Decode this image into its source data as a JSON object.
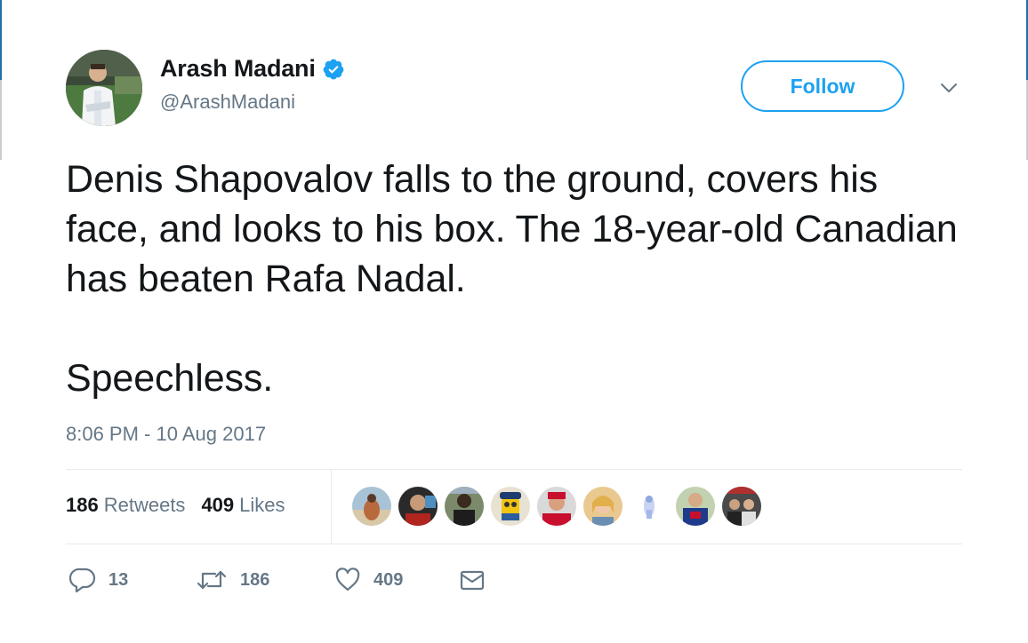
{
  "author": {
    "display_name": "Arash Madani",
    "handle": "@ArashMadani"
  },
  "follow_label": "Follow",
  "tweet": {
    "paragraph_1": "Denis Shapovalov falls to the ground, covers his face, and looks to his box. The 18-year-old Canadian has beaten Rafa Nadal.",
    "paragraph_2": "Speechless.",
    "timestamp": "8:06 PM - 10 Aug 2017"
  },
  "stats": {
    "retweets_count": "186",
    "retweets_label": "Retweets",
    "likes_count": "409",
    "likes_label": "Likes"
  },
  "actions": {
    "reply_count": "13",
    "retweet_count": "186",
    "like_count": "409"
  },
  "icons": {
    "verified": "verified-badge-icon",
    "chevron": "chevron-down-icon",
    "reply": "reply-bubble-icon",
    "retweet": "retweet-icon",
    "like": "heart-icon",
    "dm": "envelope-icon"
  },
  "colors": {
    "accent": "#1da1f2",
    "text": "#14171a",
    "secondary": "#657786",
    "divider": "#e6ecf0"
  },
  "liker_avatar_count": 9
}
